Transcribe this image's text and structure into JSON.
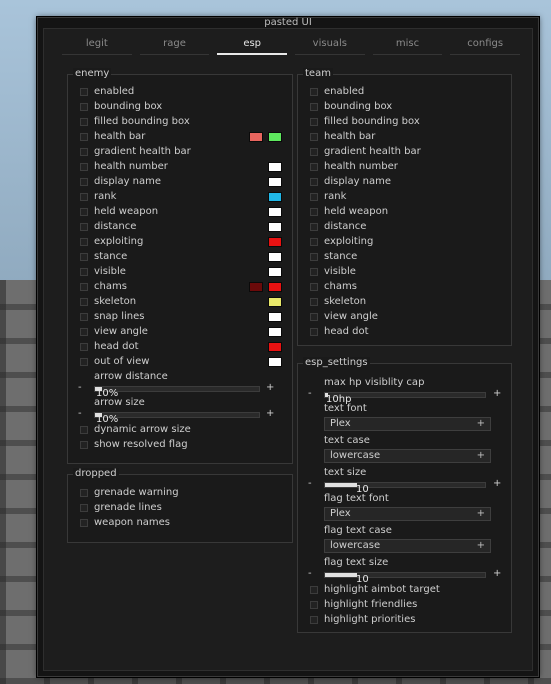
{
  "window": {
    "title": "pasted UI"
  },
  "tabs": [
    {
      "label": "legit",
      "active": false
    },
    {
      "label": "rage",
      "active": false
    },
    {
      "label": "esp",
      "active": true
    },
    {
      "label": "visuals",
      "active": false
    },
    {
      "label": "misc",
      "active": false
    },
    {
      "label": "configs",
      "active": false
    }
  ],
  "enemy": {
    "title": "enemy",
    "items": [
      {
        "label": "enabled",
        "colors": []
      },
      {
        "label": "bounding box",
        "colors": []
      },
      {
        "label": "filled bounding box",
        "colors": []
      },
      {
        "label": "health bar",
        "colors": [
          "#e8655e",
          "#5ee85e"
        ]
      },
      {
        "label": "gradient health bar",
        "colors": []
      },
      {
        "label": "health number",
        "colors": [
          "#ffffff"
        ]
      },
      {
        "label": "display name",
        "colors": [
          "#ffffff"
        ]
      },
      {
        "label": "rank",
        "colors": [
          "#21b8e8"
        ]
      },
      {
        "label": "held weapon",
        "colors": [
          "#ffffff"
        ]
      },
      {
        "label": "distance",
        "colors": [
          "#ffffff"
        ]
      },
      {
        "label": "exploiting",
        "colors": [
          "#e81212"
        ]
      },
      {
        "label": "stance",
        "colors": [
          "#ffffff"
        ]
      },
      {
        "label": "visible",
        "colors": [
          "#ffffff"
        ]
      },
      {
        "label": "chams",
        "colors": [
          "#6b0a0a",
          "#e81212"
        ]
      },
      {
        "label": "skeleton",
        "colors": [
          "#e8e86a"
        ]
      },
      {
        "label": "snap lines",
        "colors": [
          "#ffffff"
        ]
      },
      {
        "label": "view angle",
        "colors": [
          "#ffffff"
        ]
      },
      {
        "label": "head dot",
        "colors": [
          "#e81212"
        ]
      },
      {
        "label": "out of view",
        "colors": [
          "#ffffff"
        ]
      }
    ],
    "sliders": [
      {
        "label": "arrow distance",
        "value": "10%",
        "fraction": 0.04
      },
      {
        "label": "arrow size",
        "value": "10%",
        "fraction": 0.04
      }
    ],
    "after": [
      {
        "label": "dynamic arrow size"
      },
      {
        "label": "show resolved flag"
      }
    ]
  },
  "dropped": {
    "title": "dropped",
    "items": [
      {
        "label": "grenade warning"
      },
      {
        "label": "grenade lines"
      },
      {
        "label": "weapon names"
      }
    ]
  },
  "team": {
    "title": "team",
    "items": [
      {
        "label": "enabled"
      },
      {
        "label": "bounding box"
      },
      {
        "label": "filled bounding box"
      },
      {
        "label": "health bar"
      },
      {
        "label": "gradient health bar"
      },
      {
        "label": "health number"
      },
      {
        "label": "display name"
      },
      {
        "label": "rank"
      },
      {
        "label": "held weapon"
      },
      {
        "label": "distance"
      },
      {
        "label": "exploiting"
      },
      {
        "label": "stance"
      },
      {
        "label": "visible"
      },
      {
        "label": "chams"
      },
      {
        "label": "skeleton"
      },
      {
        "label": "view angle"
      },
      {
        "label": "head dot"
      }
    ]
  },
  "esp_settings": {
    "title": "esp_settings",
    "max_hp": {
      "label": "max hp visiblity cap",
      "value": "10hp",
      "fraction": 0.02
    },
    "text_font": {
      "label": "text font",
      "value": "Plex"
    },
    "text_case": {
      "label": "text case",
      "value": "lowercase"
    },
    "text_size": {
      "label": "text size",
      "value": "10",
      "fraction": 0.2
    },
    "flag_text_font": {
      "label": "flag text font",
      "value": "Plex"
    },
    "flag_text_case": {
      "label": "flag text case",
      "value": "lowercase"
    },
    "flag_text_size": {
      "label": "flag text size",
      "value": "10",
      "fraction": 0.2
    },
    "after": [
      {
        "label": "highlight aimbot target"
      },
      {
        "label": "highlight friendlies"
      },
      {
        "label": "highlight priorities"
      }
    ]
  },
  "controls": {
    "minus": "-",
    "plus": "+"
  }
}
